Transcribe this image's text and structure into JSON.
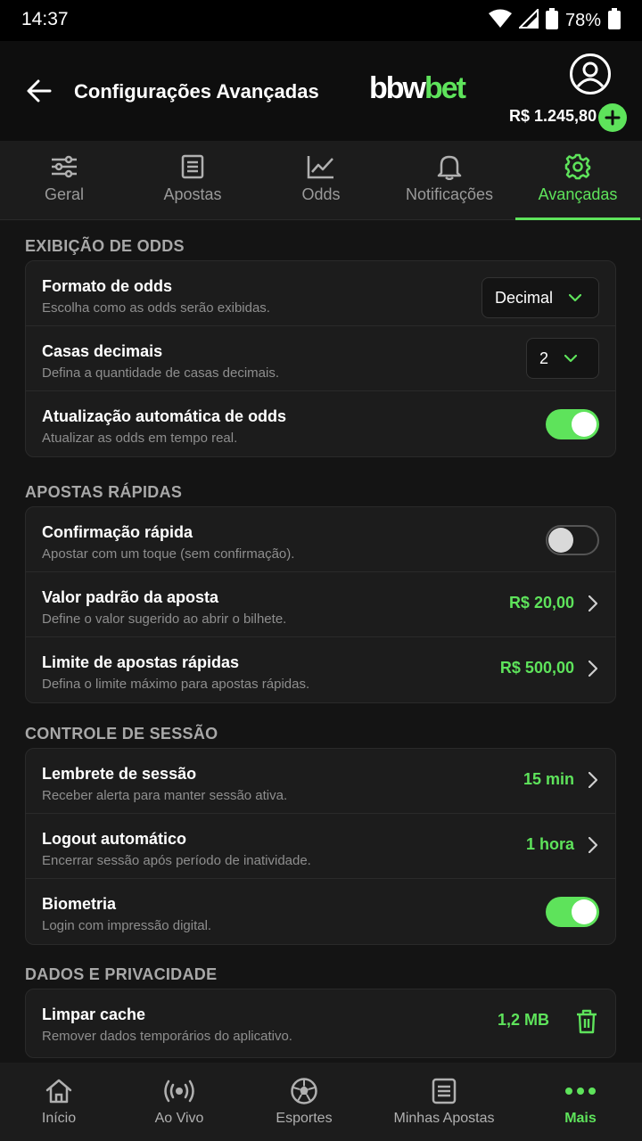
{
  "status_bar": {
    "time": "14:37",
    "battery": "78%"
  },
  "header": {
    "title": "Configurações Avançadas",
    "logo_part1": "bbw",
    "logo_part2": "bet",
    "balance": "R$ 1.245,80"
  },
  "tabs": [
    {
      "label": "Geral",
      "icon": "sliders-icon"
    },
    {
      "label": "Apostas",
      "icon": "list-icon"
    },
    {
      "label": "Odds",
      "icon": "chart-icon"
    },
    {
      "label": "Notificações",
      "icon": "bell-icon"
    },
    {
      "label": "Avançadas",
      "icon": "gear-icon",
      "active": true
    }
  ],
  "sections": {
    "odds": {
      "title": "EXIBIÇÃO DE ODDS",
      "format": {
        "label": "Formato de odds",
        "desc": "Escolha como as odds serão exibidas.",
        "value": "Decimal"
      },
      "decimals": {
        "label": "Casas decimais",
        "desc": "Defina a quantidade de casas decimais.",
        "value": "2"
      },
      "auto_update": {
        "label": "Atualização automática de odds",
        "desc": "Atualizar as odds em tempo real.",
        "enabled": true
      }
    },
    "quick_bets": {
      "title": "APOSTAS RÁPIDAS",
      "quick_confirm": {
        "label": "Confirmação rápida",
        "desc": "Apostar com um toque (sem confirmação).",
        "enabled": false
      },
      "default_stake": {
        "label": "Valor padrão da aposta",
        "desc": "Define o valor sugerido ao abrir o bilhete.",
        "value": "R$ 20,00"
      },
      "quick_limit": {
        "label": "Limite de apostas rápidas",
        "desc": "Defina o limite máximo para apostas rápidas.",
        "value": "R$ 500,00"
      }
    },
    "session": {
      "title": "CONTROLE DE SESSÃO",
      "reminder": {
        "label": "Lembrete de sessão",
        "desc": "Receber alerta para manter sessão ativa.",
        "value": "15 min"
      },
      "auto_logout": {
        "label": "Logout automático",
        "desc": "Encerrar sessão após período de inatividade.",
        "value": "1 hora"
      },
      "biometrics": {
        "label": "Biometria",
        "desc": "Login com impressão digital.",
        "enabled": true
      }
    },
    "privacy": {
      "title": "DADOS E PRIVACIDADE",
      "clear_cache": {
        "label": "Limpar cache",
        "desc": "Remover dados temporários do aplicativo.",
        "value": "1,2 MB"
      }
    }
  },
  "bottom_nav": [
    {
      "label": "Início",
      "icon": "home-icon"
    },
    {
      "label": "Ao Vivo",
      "icon": "live-icon"
    },
    {
      "label": "Esportes",
      "icon": "soccer-ball-icon"
    },
    {
      "label": "Minhas Apostas",
      "icon": "ticket-icon"
    },
    {
      "label": "Mais",
      "icon": "more-icon",
      "active": true
    }
  ],
  "colors": {
    "accent": "#5ee35b",
    "background": "#141414",
    "card": "#1c1c1c",
    "muted_text": "#8e8e8e"
  }
}
